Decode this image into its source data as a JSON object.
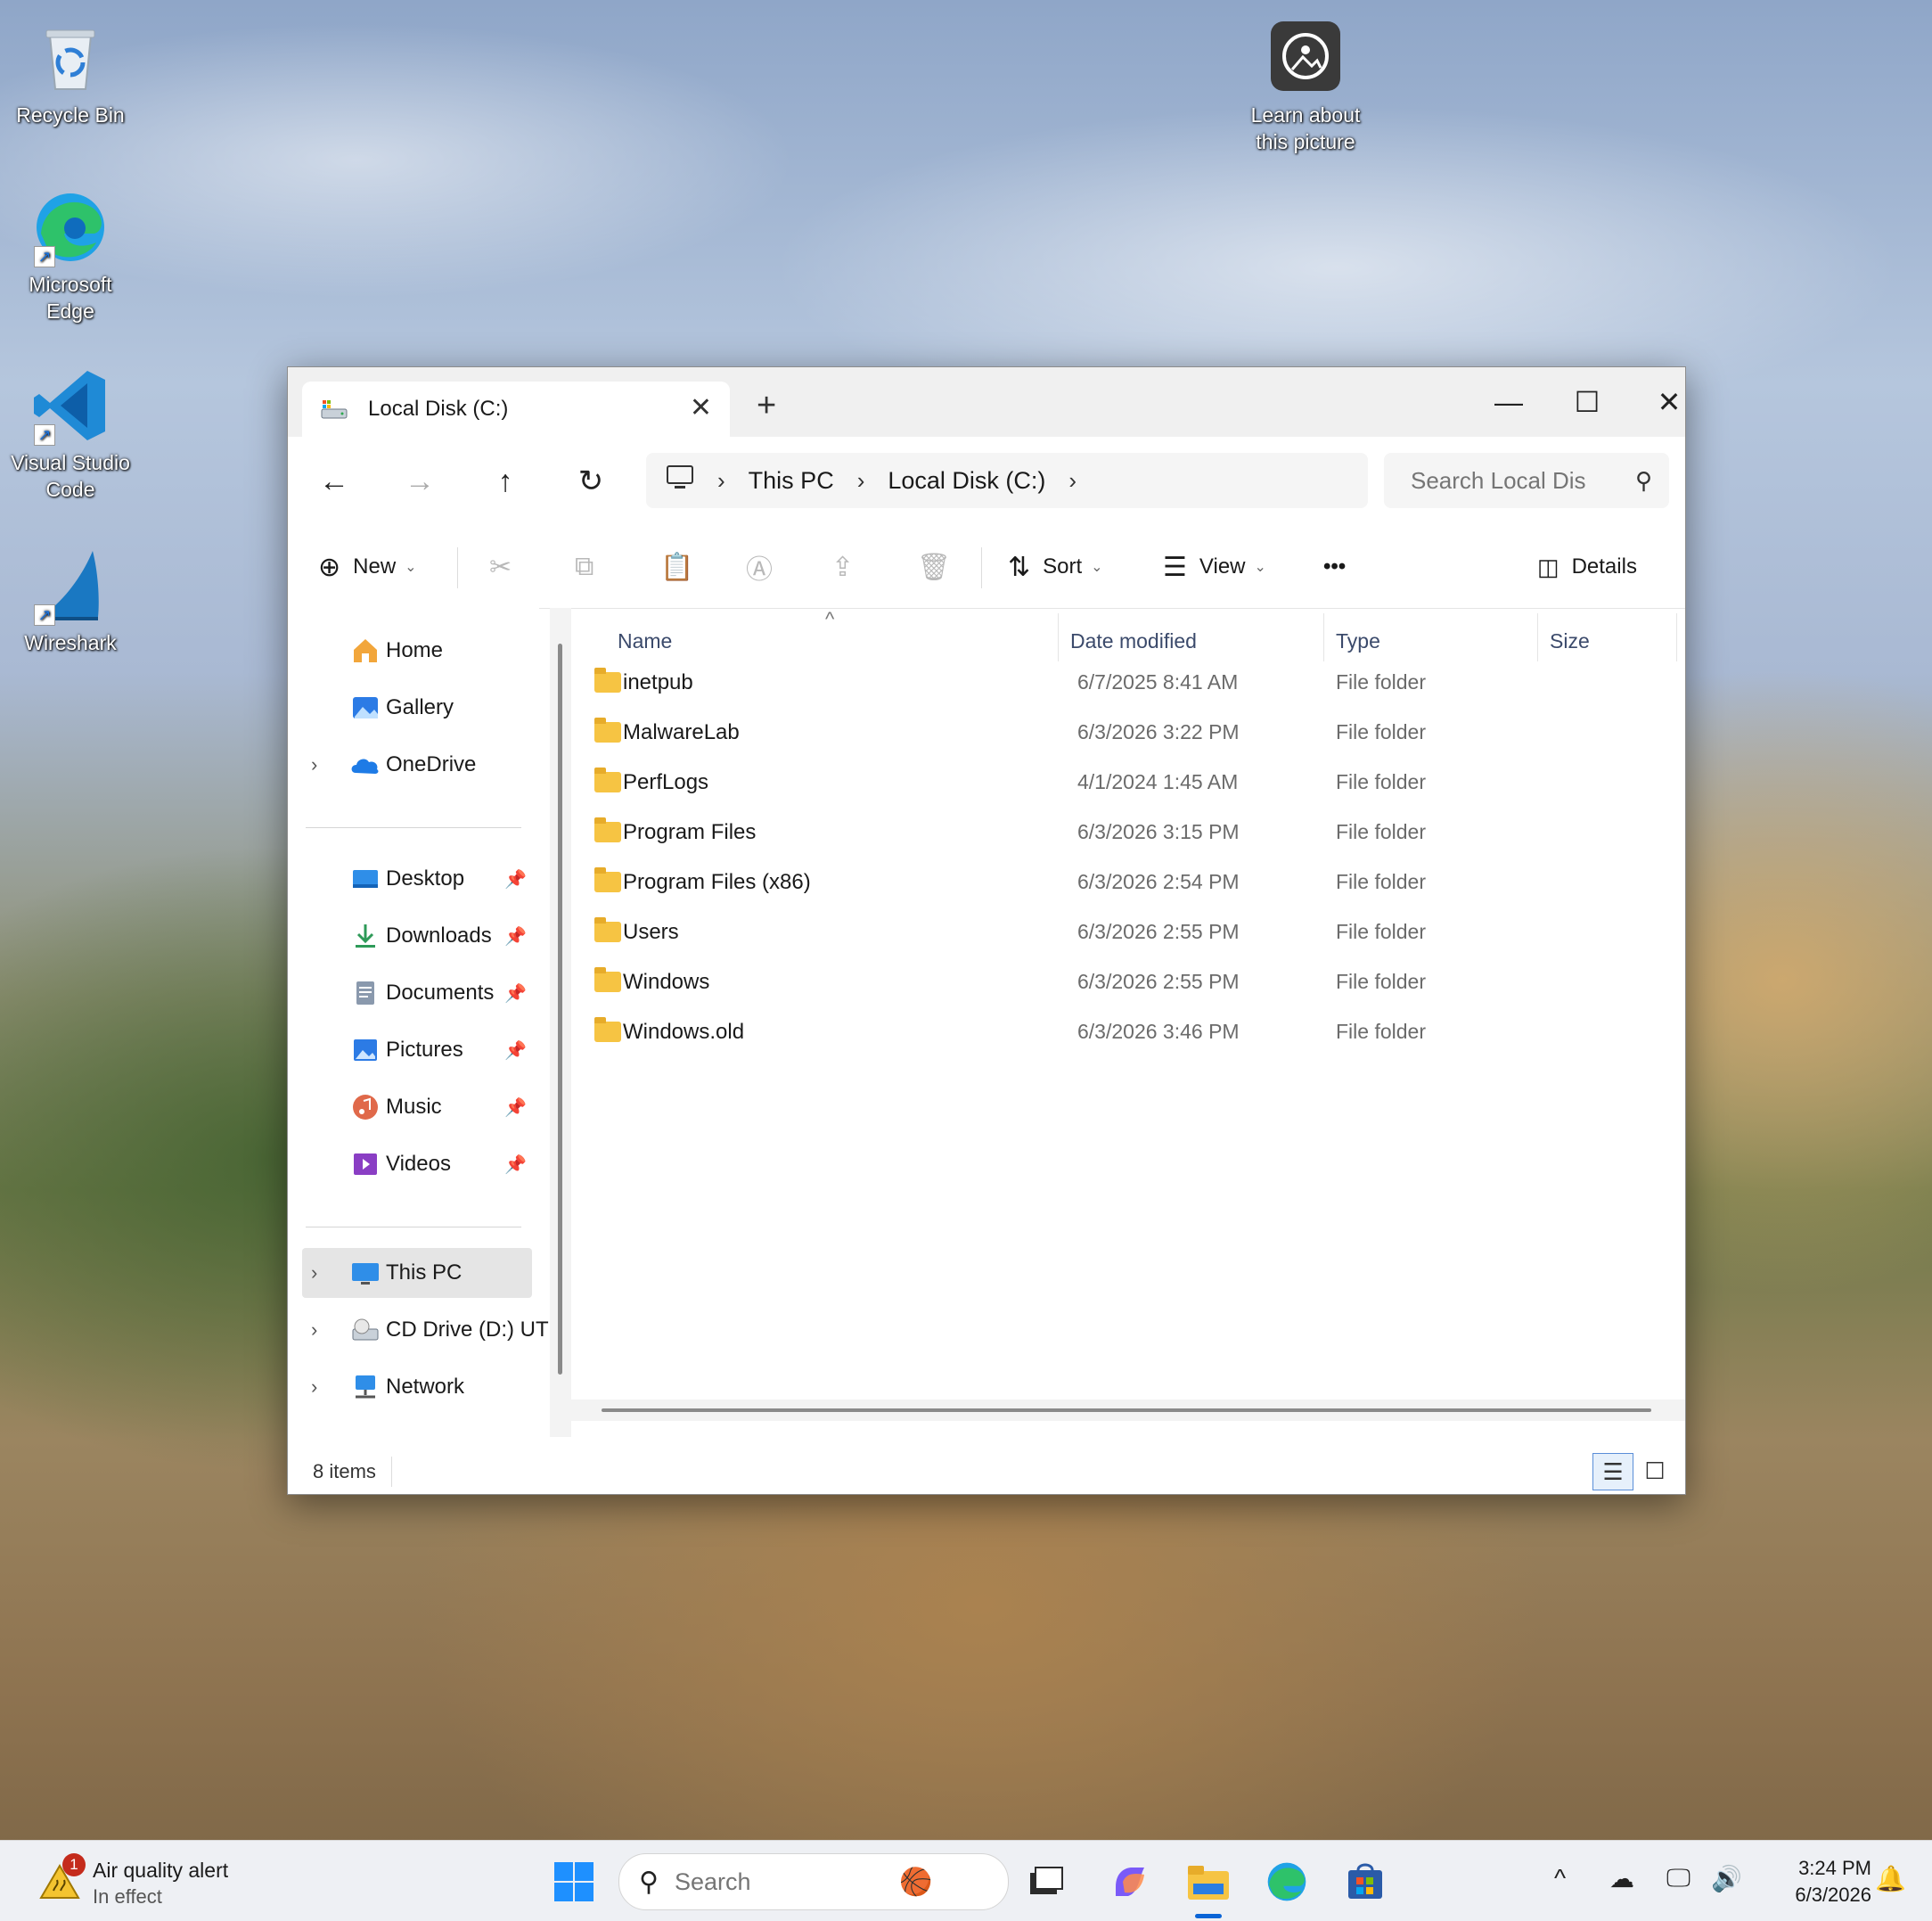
{
  "desktop": {
    "icons": {
      "recycle_bin": "Recycle Bin",
      "edge_line1": "Microsoft",
      "edge_line2": "Edge",
      "vscode_line1": "Visual Studio",
      "vscode_line2": "Code",
      "wireshark": "Wireshark",
      "learn_line1": "Learn about",
      "learn_line2": "this picture"
    }
  },
  "explorer": {
    "tab_title": "Local Disk (C:)",
    "new_tab": "+",
    "window_controls": {
      "minimize": "—",
      "maximize": "☐",
      "close": "✕"
    },
    "address": {
      "crumbs": [
        "This PC",
        "Local Disk (C:)"
      ]
    },
    "search_placeholder": "Search Local Dis",
    "commands": {
      "new": "New",
      "sort": "Sort",
      "view": "View",
      "more": "•••",
      "details": "Details"
    },
    "sidebar": {
      "home": "Home",
      "gallery": "Gallery",
      "onedrive": "OneDrive",
      "desktop": "Desktop",
      "downloads": "Downloads",
      "documents": "Documents",
      "pictures": "Pictures",
      "music": "Music",
      "videos": "Videos",
      "this_pc": "This PC",
      "cd_drive": "CD Drive (D:) UT",
      "network": "Network"
    },
    "columns": {
      "name": "Name",
      "date": "Date modified",
      "type": "Type",
      "size": "Size"
    },
    "files": [
      {
        "name": "inetpub",
        "date": "6/7/2025 8:41 AM",
        "type": "File folder"
      },
      {
        "name": "MalwareLab",
        "date": "6/3/2026 3:22 PM",
        "type": "File folder"
      },
      {
        "name": "PerfLogs",
        "date": "4/1/2024 1:45 AM",
        "type": "File folder"
      },
      {
        "name": "Program Files",
        "date": "6/3/2026 3:15 PM",
        "type": "File folder"
      },
      {
        "name": "Program Files (x86)",
        "date": "6/3/2026 2:54 PM",
        "type": "File folder"
      },
      {
        "name": "Users",
        "date": "6/3/2026 2:55 PM",
        "type": "File folder"
      },
      {
        "name": "Windows",
        "date": "6/3/2026 2:55 PM",
        "type": "File folder"
      },
      {
        "name": "Windows.old",
        "date": "6/3/2026 3:46 PM",
        "type": "File folder"
      }
    ],
    "status": {
      "item_count": "8 items"
    }
  },
  "taskbar": {
    "weather_title": "Air quality alert",
    "weather_sub": "In effect",
    "weather_badge": "1",
    "search_placeholder": "Search",
    "clock_time": "3:24 PM",
    "clock_date": "6/3/2026"
  },
  "colors": {
    "accent": "#0a64d6",
    "folder": "#f6c443",
    "taskbar_bg": "#eef0f4",
    "selected_bg": "#e5e5e5"
  }
}
